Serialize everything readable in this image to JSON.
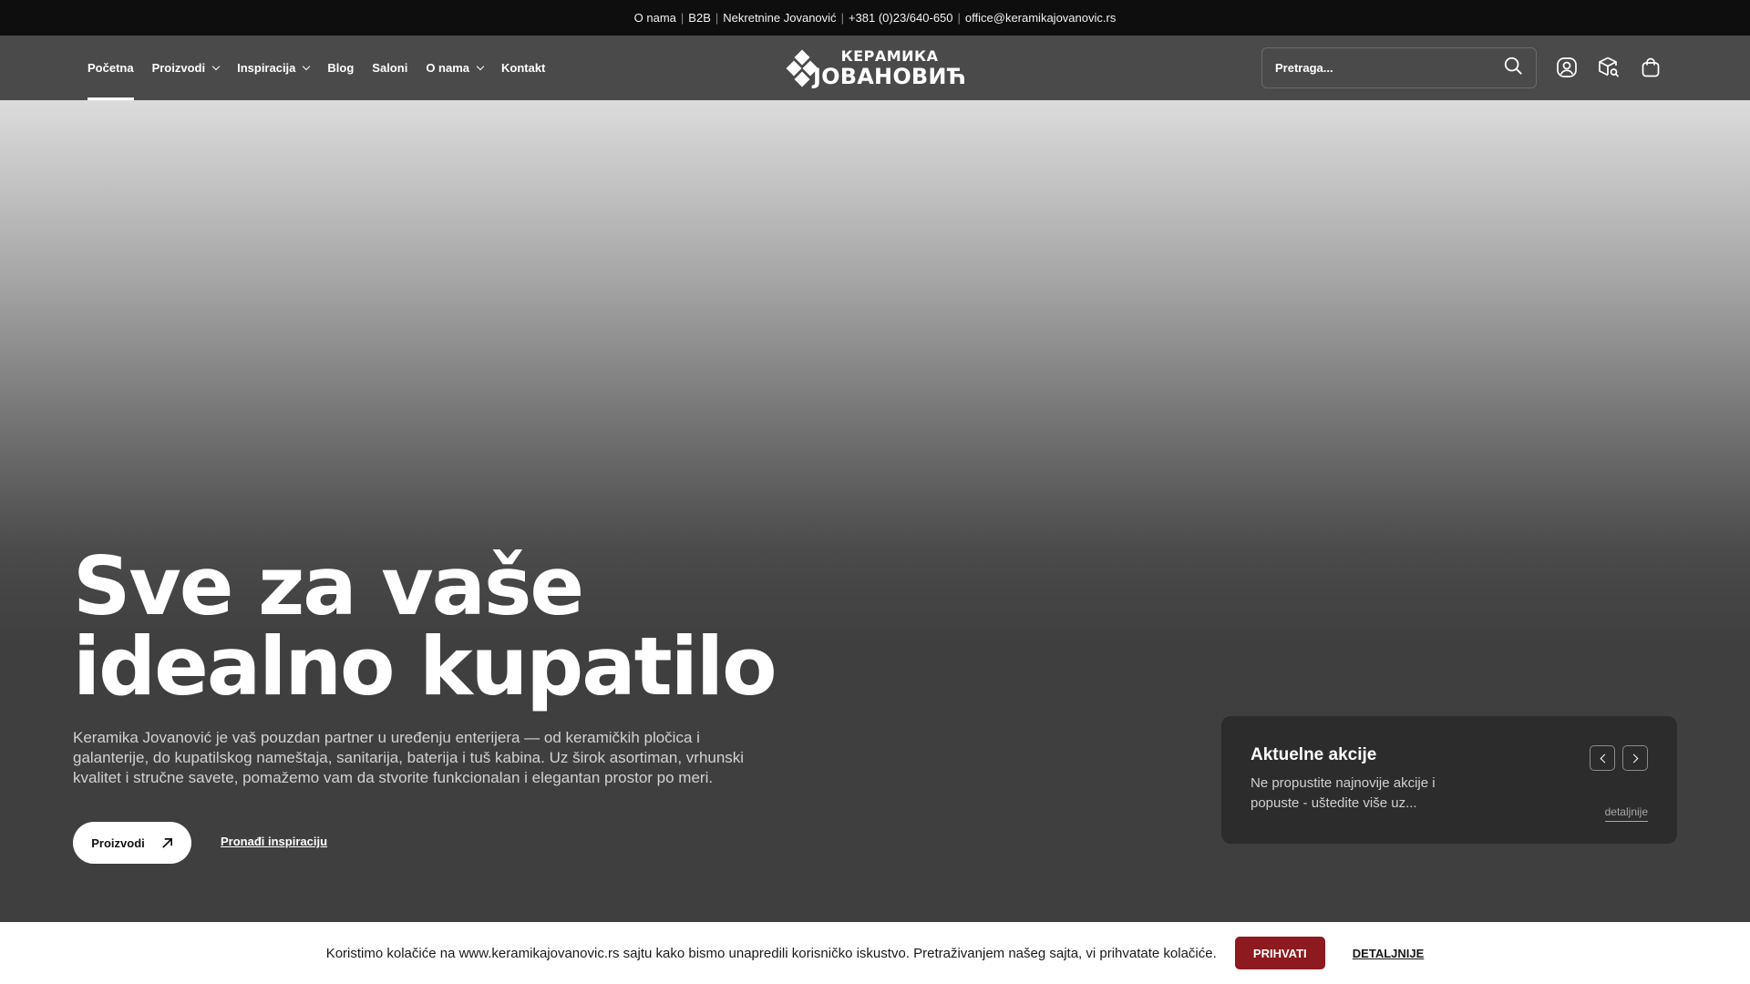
{
  "topbar": {
    "links": [
      "O nama",
      "B2B",
      "Nekretnine Jovanović",
      "+381 (0)23/640-650",
      "office@keramikajovanovic.rs"
    ],
    "separator": "|"
  },
  "nav": {
    "items": [
      {
        "label": "Početna",
        "active": true,
        "dropdown": false
      },
      {
        "label": "Proizvodi",
        "active": false,
        "dropdown": true
      },
      {
        "label": "Inspiracija",
        "active": false,
        "dropdown": true
      },
      {
        "label": "Blog",
        "active": false,
        "dropdown": false
      },
      {
        "label": "Saloni",
        "active": false,
        "dropdown": false
      },
      {
        "label": "O nama",
        "active": false,
        "dropdown": true
      },
      {
        "label": "Kontakt",
        "active": false,
        "dropdown": false
      }
    ]
  },
  "logo": {
    "line1": "КЕРАМИКА",
    "line2": "ЈОВАНОВИЋ"
  },
  "search": {
    "placeholder": "Pretraga...",
    "icon": "search-icon"
  },
  "header_icons": [
    "user-icon",
    "package-search-icon",
    "cart-icon"
  ],
  "hero": {
    "title_line1": "Sve za vaše",
    "title_line2": "idealno kupatilo",
    "description": "Keramika Jovanović je vaš pouzdan partner u uređenju enterijera — od keramičkih pločica i galanterije, do kupatilskog nameštaja, sanitarija, baterija i tuš kabina. Uz širok asortiman, vrhunski kvalitet i stručne savete, pomažemo vam da stvorite funkcionalan i elegantan prostor po meri.",
    "primary_button": "Proizvodi",
    "secondary_link": "Pronađi inspiraciju"
  },
  "promo": {
    "title": "Aktuelne akcije",
    "text": "Ne propustite najnovije akcije i popuste - uštedite više uz...",
    "link": "detaljnije"
  },
  "cookie": {
    "text": "Koristimo kolačiće na www.keramikajovanovic.rs sajtu kako bismo unapredili korisničko iskustvo. Pretraživanjem našeg sajta, vi prihvatate kolačiće.",
    "accept": "PRIHVATI",
    "details": "DETALJNIJE"
  },
  "colors": {
    "topbar_bg": "#0e0e0e",
    "header_bg": "#4a4a4a",
    "accept_button": "#8c1a1e",
    "promo_bg": "#2c2c2c"
  }
}
